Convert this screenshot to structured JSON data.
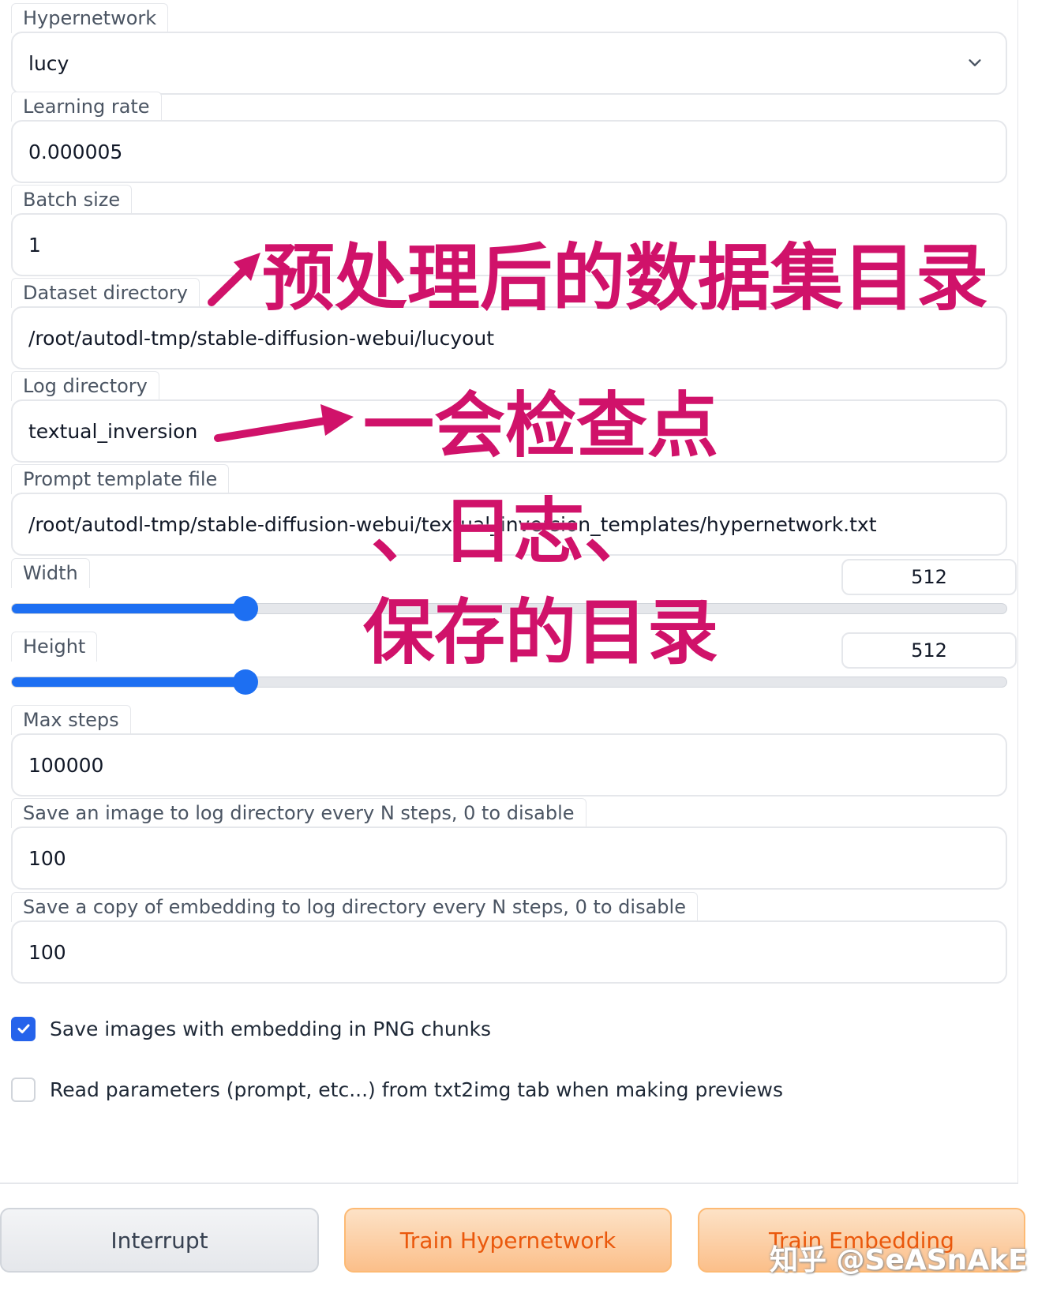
{
  "fields": {
    "hypernetwork": {
      "label": "Hypernetwork",
      "value": "lucy"
    },
    "learning_rate": {
      "label": "Learning rate",
      "value": "0.000005"
    },
    "batch_size": {
      "label": "Batch size",
      "value": "1"
    },
    "dataset_directory": {
      "label": "Dataset directory",
      "value": "/root/autodl-tmp/stable-diffusion-webui/lucyout"
    },
    "log_directory": {
      "label": "Log directory",
      "value": "textual_inversion"
    },
    "prompt_template_file": {
      "label": "Prompt template file",
      "value": "/root/autodl-tmp/stable-diffusion-webui/textual_inversion_templates/hypernetwork.txt"
    },
    "max_steps": {
      "label": "Max steps",
      "value": "100000"
    },
    "save_image_every": {
      "label": "Save an image to log directory every N steps, 0 to disable",
      "value": "100"
    },
    "save_embedding_every": {
      "label": "Save a copy of embedding to log directory every N steps, 0 to disable",
      "value": "100"
    }
  },
  "sliders": {
    "width": {
      "label": "Width",
      "value": "512",
      "fraction": 0.235
    },
    "height": {
      "label": "Height",
      "value": "512",
      "fraction": 0.235
    }
  },
  "checkboxes": {
    "save_png_chunks": {
      "label": "Save images with embedding in PNG chunks",
      "checked": true
    },
    "read_params": {
      "label": "Read parameters (prompt, etc...) from txt2img tab when making previews",
      "checked": false
    }
  },
  "buttons": {
    "interrupt": "Interrupt",
    "train_hypernetwork": "Train Hypernetwork",
    "train_embedding": "Train Embedding"
  },
  "annotations": {
    "dataset_note": "预处理后的数据集目录",
    "log_note_line1": "一会检查点",
    "log_note_line2": "、日志、",
    "log_note_line3": "保存的目录"
  },
  "watermark": "知乎 @SeASnAkE",
  "colors": {
    "accent_blue": "#1d6ff2",
    "annotation_magenta": "#d0126a",
    "button_orange_text": "#ea580c"
  },
  "icons": {
    "dropdown": "chevron-down-icon",
    "checkbox_checked": "check-icon"
  }
}
